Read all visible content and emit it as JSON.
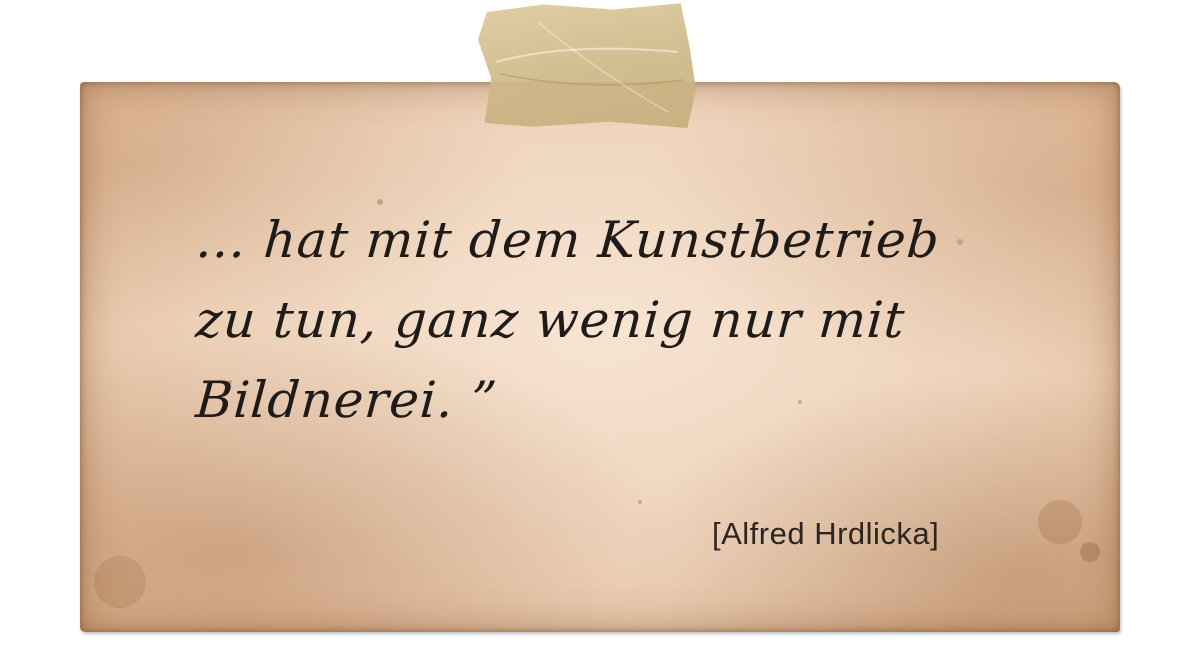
{
  "quote": {
    "lines": [
      "… hat mit dem Kunstbetrieb",
      "zu tun, ganz wenig nur mit",
      "Bildnerei. ”"
    ]
  },
  "author": "[Alfred Hrdlicka]",
  "colors": {
    "paper": "#efd3ba",
    "paper_edge": "#c8915f",
    "ink": "#1f1b18",
    "tape": "#d6c197",
    "background": "#ffffff"
  }
}
